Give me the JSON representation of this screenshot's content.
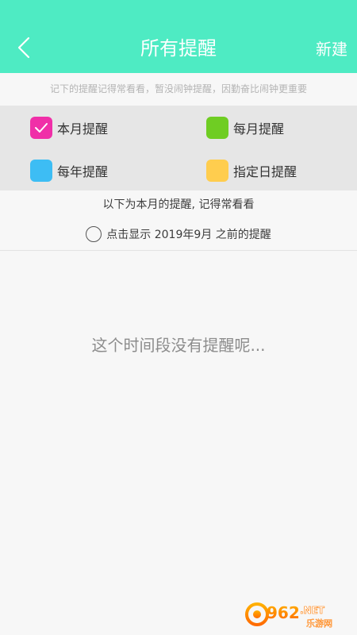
{
  "header": {
    "title": "所有提醒",
    "new_label": "新建",
    "background_color": "#4eebc3"
  },
  "hint": "记下的提醒记得常看看，暂没闹钟提醒，因勤奋比闹钟更重要",
  "legend": {
    "items": [
      {
        "label": "本月提醒",
        "color": "#f02fa8",
        "checked": true
      },
      {
        "label": "每月提醒",
        "color": "#6fcd23",
        "checked": false
      },
      {
        "label": "每年提醒",
        "color": "#3dbdf4",
        "checked": false
      },
      {
        "label": "指定日提醒",
        "color": "#ffcd4e",
        "checked": false
      }
    ]
  },
  "info_text": "以下为本月的提醒, 记得常看看",
  "earlier_option": {
    "label": "点击显示 2019年9月 之前的提醒",
    "selected": false
  },
  "empty_text": "这个时间段没有提醒呢...",
  "icons": {
    "back": "chevron-left-icon",
    "check": "checkmark-icon",
    "radio": "radio-empty-icon"
  },
  "watermark": {
    "brand": "962",
    "suffix": ".NET",
    "subtitle": "乐游网"
  }
}
